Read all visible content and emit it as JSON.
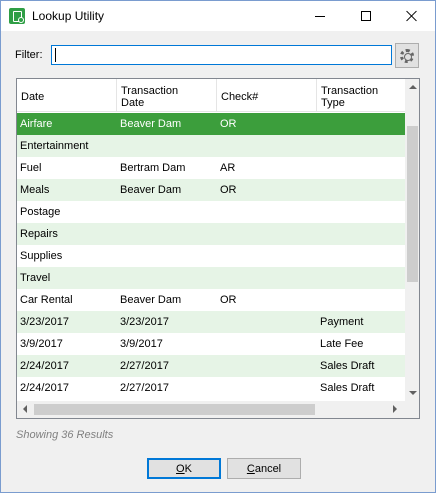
{
  "window": {
    "title": "Lookup Utility",
    "accent_color": "#0078d7",
    "selected_row_color": "#3c9e3c",
    "alt_row_color": "#e6f4e6"
  },
  "filter": {
    "label": "Filter:",
    "value": ""
  },
  "grid": {
    "columns": [
      {
        "line1": "Date",
        "line2": ""
      },
      {
        "line1": "Transaction",
        "line2": "Date"
      },
      {
        "line1": "Check#",
        "line2": ""
      },
      {
        "line1": "Transaction",
        "line2": "Type"
      }
    ],
    "rows": [
      {
        "c0": "Airfare",
        "c1": "Beaver Dam",
        "c2": "OR",
        "c3": "",
        "selected": true
      },
      {
        "c0": "Entertainment",
        "c1": "",
        "c2": "",
        "c3": ""
      },
      {
        "c0": "Fuel",
        "c1": "Bertram Dam",
        "c2": "AR",
        "c3": ""
      },
      {
        "c0": "Meals",
        "c1": "Beaver Dam",
        "c2": "OR",
        "c3": ""
      },
      {
        "c0": "Postage",
        "c1": "",
        "c2": "",
        "c3": ""
      },
      {
        "c0": "Repairs",
        "c1": "",
        "c2": "",
        "c3": ""
      },
      {
        "c0": "Supplies",
        "c1": "",
        "c2": "",
        "c3": ""
      },
      {
        "c0": "Travel",
        "c1": "",
        "c2": "",
        "c3": ""
      },
      {
        "c0": "Car Rental",
        "c1": "Beaver Dam",
        "c2": "OR",
        "c3": ""
      },
      {
        "c0": "3/23/2017",
        "c1": "3/23/2017",
        "c2": "",
        "c3": "Payment"
      },
      {
        "c0": "3/9/2017",
        "c1": "3/9/2017",
        "c2": "",
        "c3": "Late Fee"
      },
      {
        "c0": "2/24/2017",
        "c1": "2/27/2017",
        "c2": "",
        "c3": "Sales Draft"
      },
      {
        "c0": "2/24/2017",
        "c1": "2/27/2017",
        "c2": "",
        "c3": "Sales Draft"
      }
    ]
  },
  "status": {
    "text": "Showing 36 Results"
  },
  "buttons": {
    "ok_mnemonic": "O",
    "ok_rest": "K",
    "cancel_mnemonic": "C",
    "cancel_rest": "ancel"
  }
}
